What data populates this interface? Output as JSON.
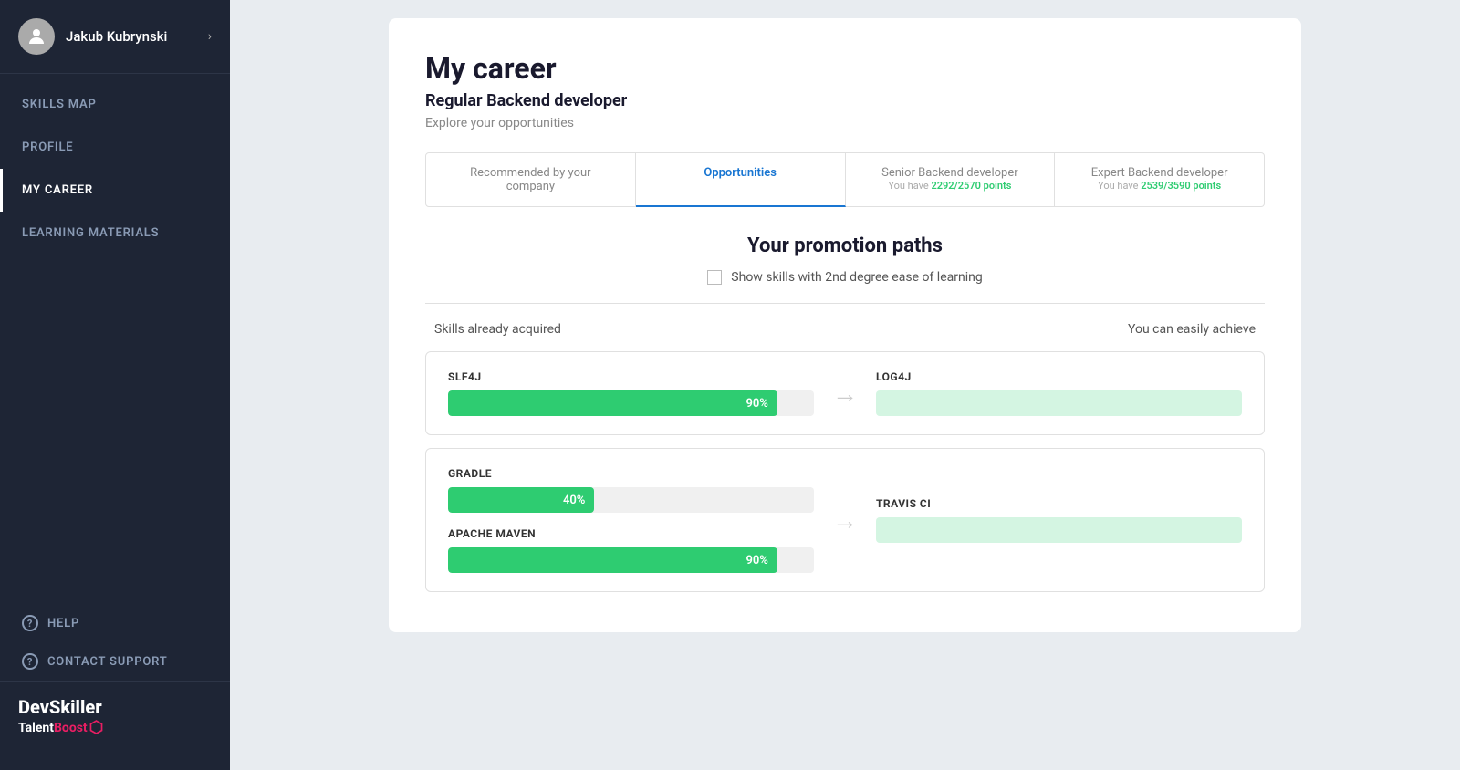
{
  "sidebar": {
    "user": {
      "name": "Jakub Kubrynski"
    },
    "nav_items": [
      {
        "id": "skills-map",
        "label": "SKILLS MAP",
        "active": false
      },
      {
        "id": "profile",
        "label": "PROFILE",
        "active": false
      },
      {
        "id": "my-career",
        "label": "MY CAREER",
        "active": true
      },
      {
        "id": "learning-materials",
        "label": "LEARNING MATERIALS",
        "active": false
      }
    ],
    "help_label": "HELP",
    "contact_support_label": "CONTACT SUPPORT",
    "brand": {
      "dev": "Dev",
      "skiller": "Skiller",
      "talent": "Talent",
      "boost": "Boost"
    }
  },
  "main": {
    "title": "My career",
    "subtitle": "Regular Backend developer",
    "explore": "Explore your opportunities",
    "tabs": [
      {
        "id": "recommended",
        "label": "Recommended by your\ncompany",
        "active": false
      },
      {
        "id": "opportunities",
        "label": "Opportunities",
        "active": true
      },
      {
        "id": "senior",
        "label": "Senior Backend developer",
        "sub": "You have",
        "points": "2292/2570 points"
      },
      {
        "id": "expert",
        "label": "Expert Backend developer",
        "sub": "You have",
        "points": "2539/3590 points"
      }
    ],
    "promotion_title": "Your promotion paths",
    "checkbox_label": "Show skills with 2nd degree ease of learning",
    "col_acquired": "Skills already acquired",
    "col_achieve": "You can easily achieve",
    "skills": [
      {
        "left_name": "SLF4J",
        "left_percent": 90,
        "left_label": "90%",
        "right_name": "LOG4J"
      },
      {
        "left_name": "GRADLE",
        "left_percent": 40,
        "left_label": "40%",
        "right_name": "TRAVIS CI"
      },
      {
        "left_name": "APACHE MAVEN",
        "left_percent": 90,
        "left_label": "90%",
        "right_name": ""
      }
    ]
  }
}
